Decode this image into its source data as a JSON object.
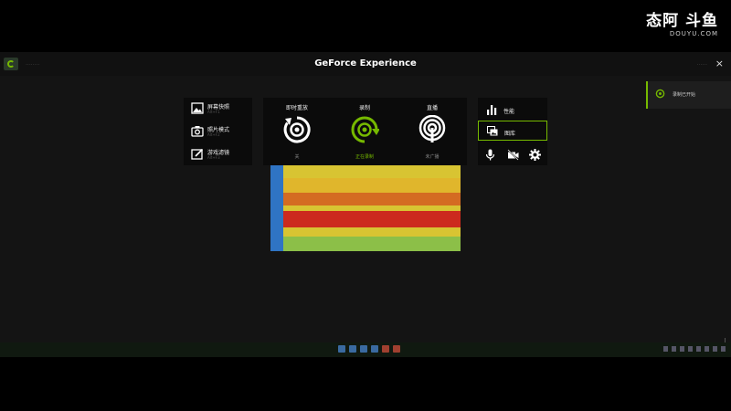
{
  "watermark": {
    "main": "斗鱼",
    "prefix": "态阿",
    "sub": "DOUYU.COM"
  },
  "overlay": {
    "title": "GeForce Experience",
    "user": "........",
    "share_hint": "......",
    "close": "×"
  },
  "notice": {
    "text": "录制已开始"
  },
  "left_panel": {
    "items": [
      {
        "label": "屏幕快照",
        "sub": "Alt+F1",
        "icon": "image-icon"
      },
      {
        "label": "照片模式",
        "sub": "Alt+F2",
        "icon": "camera-icon"
      },
      {
        "label": "游戏滤镜",
        "sub": "Alt+F3",
        "icon": "edit-icon"
      }
    ]
  },
  "center_panel": {
    "items": [
      {
        "label": "即时重放",
        "state": "关",
        "icon": "instant-replay-icon",
        "active": false
      },
      {
        "label": "录制",
        "state": "正在录制",
        "icon": "record-icon",
        "active": true
      },
      {
        "label": "直播",
        "state": "未广播",
        "icon": "broadcast-icon",
        "active": false
      }
    ]
  },
  "right_panel": {
    "performance_label": "性能",
    "gallery_label": "图库",
    "icons": [
      "microphone-icon",
      "camera-off-icon",
      "settings-icon"
    ]
  },
  "colors": {
    "accent": "#76b900",
    "panel": "#0b0b0b",
    "background": "#141414"
  }
}
